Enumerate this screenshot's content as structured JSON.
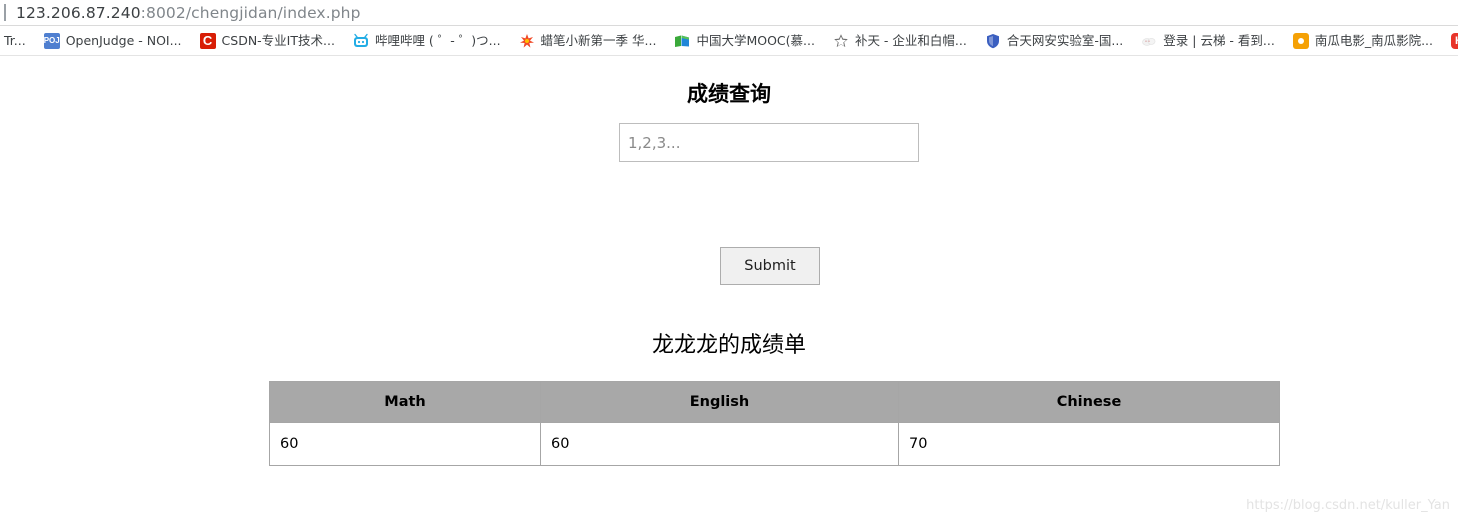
{
  "browser": {
    "omnibox": {
      "url_host": "123.206.87.240",
      "url_path": ":8002/chengjidan/index.php"
    },
    "bookmarks": [
      {
        "label": "Tr...",
        "icon": "none"
      },
      {
        "label": "OpenJudge - NOI...",
        "icon": "poj-icon",
        "icon_text": "POJ"
      },
      {
        "label": "CSDN-专业IT技术...",
        "icon": "csdn-icon",
        "icon_text": "C"
      },
      {
        "label": "哔哩哔哩 ( ゜- ゜)つ...",
        "icon": "bilibili-icon"
      },
      {
        "label": "蜡笔小新第一季 华...",
        "icon": "sohu-icon"
      },
      {
        "label": "中国大学MOOC(慕...",
        "icon": "mooc-book-icon"
      },
      {
        "label": "补天 - 企业和白帽...",
        "icon": "star-icon"
      },
      {
        "label": "合天网安实验室-国...",
        "icon": "shield-icon"
      },
      {
        "label": "登录 | 云梯 - 看到...",
        "icon": "cloud-icon"
      },
      {
        "label": "南瓜电影_南瓜影院...",
        "icon": "pumpkin-icon"
      },
      {
        "label": "H",
        "icon": "h-icon",
        "icon_text": "H"
      }
    ]
  },
  "page": {
    "title": "成绩查询",
    "query_input": {
      "placeholder": "1,2,3...",
      "value": ""
    },
    "submit_label": "Submit",
    "report_title": "龙龙龙的成绩单",
    "table": {
      "headers": [
        "Math",
        "English",
        "Chinese"
      ],
      "rows": [
        [
          "60",
          "60",
          "70"
        ]
      ]
    },
    "watermark": "https://blog.csdn.net/kuller_Yan"
  },
  "colors": {
    "table_header_bg": "#a8a8a8",
    "table_border": "#a6a6a6",
    "button_bg": "#f0f0f0",
    "watermark": "#e3e3e3"
  }
}
